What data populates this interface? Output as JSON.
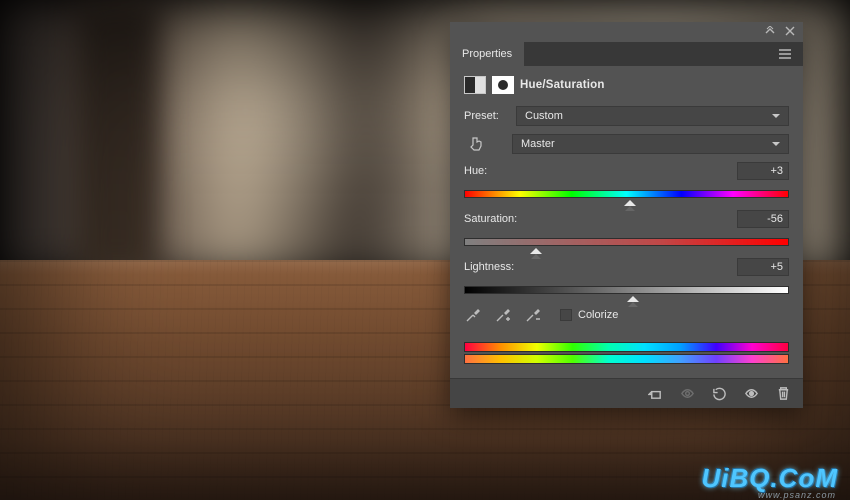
{
  "panel": {
    "title_tab": "Properties",
    "adjustment_name": "Hue/Saturation",
    "preset_label": "Preset:",
    "preset_value": "Custom",
    "channel_value": "Master",
    "sliders": {
      "hue": {
        "label": "Hue:",
        "value": "+3",
        "pct": 51
      },
      "saturation": {
        "label": "Saturation:",
        "value": "-56",
        "pct": 22
      },
      "lightness": {
        "label": "Lightness:",
        "value": "+5",
        "pct": 52
      }
    },
    "colorize_label": "Colorize",
    "colorize_checked": false
  },
  "watermark": {
    "main": "UiBQ.CoM",
    "sub": "www.psanz.com"
  }
}
